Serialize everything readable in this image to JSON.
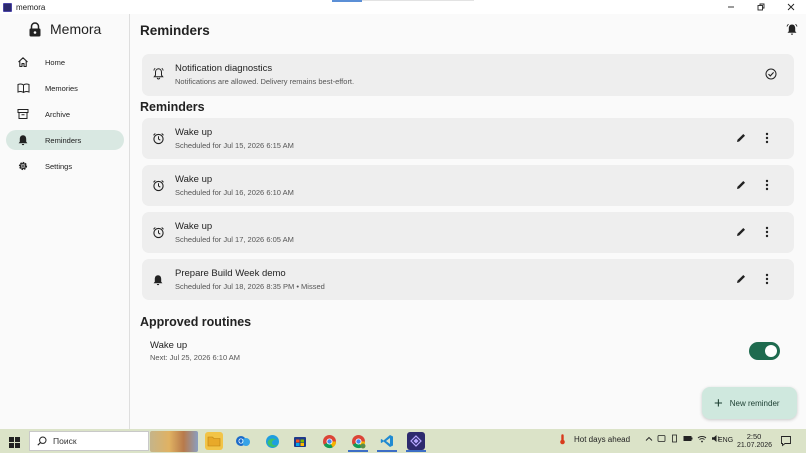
{
  "window": {
    "title": "memora",
    "controls": [
      "minimize",
      "maximize",
      "close"
    ]
  },
  "sidebar": {
    "brand": "Memora",
    "items": [
      {
        "label": "Home",
        "icon": "home-icon",
        "active": false
      },
      {
        "label": "Memories",
        "icon": "book-icon",
        "active": false
      },
      {
        "label": "Archive",
        "icon": "archive-icon",
        "active": false
      },
      {
        "label": "Reminders",
        "icon": "bell-icon",
        "active": true
      },
      {
        "label": "Settings",
        "icon": "gear-icon",
        "active": false
      }
    ]
  },
  "main": {
    "page_title": "Reminders",
    "diagnostics": {
      "title": "Notification diagnostics",
      "subtitle": "Notifications are allowed. Delivery remains best-effort."
    },
    "reminders_heading": "Reminders",
    "reminders": [
      {
        "title": "Wake up",
        "subtitle": "Scheduled for Jul 15, 2026 6:15 AM",
        "icon": "alarm-icon"
      },
      {
        "title": "Wake up",
        "subtitle": "Scheduled for Jul 16, 2026 6:10 AM",
        "icon": "alarm-icon"
      },
      {
        "title": "Wake up",
        "subtitle": "Scheduled for Jul 17, 2026 6:05 AM",
        "icon": "alarm-icon"
      },
      {
        "title": "Prepare Build Week demo",
        "subtitle": "Scheduled for Jul 18, 2026 8:35 PM • Missed",
        "icon": "bell-icon"
      }
    ],
    "routines_heading": "Approved routines",
    "routine": {
      "title": "Wake up",
      "subtitle": "Next: Jul 25, 2026 6:10 AM",
      "enabled": true
    },
    "fab_label": "New reminder"
  },
  "taskbar": {
    "search_label": "Поиск",
    "weather": "Hot days ahead",
    "language": "ENG",
    "time": "2:50",
    "date": "21.07.2026"
  },
  "colors": {
    "accent": "#1f6b4f",
    "active_nav": "#d9e8e2",
    "fab": "#cfe8de",
    "card": "#eeeeee",
    "taskbar": "#dbe3c8"
  }
}
